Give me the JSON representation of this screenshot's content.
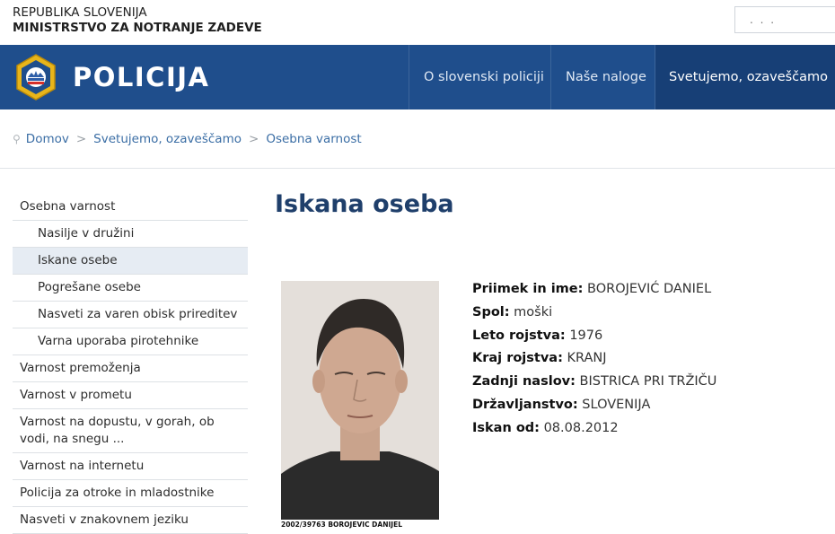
{
  "header": {
    "gov_line1": "REPUBLIKA SLOVENIJA",
    "gov_line2": "MINISTRSTVO ZA NOTRANJE ZADEVE",
    "search_placeholder": ". . ."
  },
  "nav": {
    "brand": "POLICIJA",
    "items": [
      {
        "label": "O slovenski policiji"
      },
      {
        "label": "Naše naloge"
      },
      {
        "label": "Svetujemo, ozaveščamo"
      }
    ]
  },
  "breadcrumb": [
    "Domov",
    "Svetujemo, ozaveščamo",
    "Osebna varnost"
  ],
  "sidebar": {
    "items": [
      {
        "label": "Osebna varnost"
      },
      {
        "label": "Nasilje v družini"
      },
      {
        "label": "Iskane osebe"
      },
      {
        "label": "Pogrešane osebe"
      },
      {
        "label": "Nasveti za varen obisk prireditev"
      },
      {
        "label": "Varna uporaba pirotehnike"
      },
      {
        "label": "Varnost premoženja"
      },
      {
        "label": "Varnost v prometu"
      },
      {
        "label": "Varnost na dopustu, v gorah, ob vodi, na snegu ..."
      },
      {
        "label": "Varnost na internetu"
      },
      {
        "label": "Policija za otroke in mladostnike"
      },
      {
        "label": "Nasveti v znakovnem jeziku"
      }
    ]
  },
  "main": {
    "title": "Iskana oseba",
    "photo_caption": "2002/39763 BOROJEVIC DANIJEL",
    "fields": [
      {
        "label": "Priimek in ime:",
        "value": "BOROJEVIĆ DANIEL"
      },
      {
        "label": "Spol:",
        "value": "moški"
      },
      {
        "label": "Leto rojstva:",
        "value": "1976"
      },
      {
        "label": "Kraj rojstva:",
        "value": "KRANJ"
      },
      {
        "label": "Zadnji naslov:",
        "value": "BISTRICA PRI TRŽIČU"
      },
      {
        "label": "Državljanstvo:",
        "value": "SLOVENIJA"
      },
      {
        "label": "Iskan od:",
        "value": "08.08.2012"
      }
    ]
  },
  "colors": {
    "navbar": "#1f4e8c",
    "title": "#1f3f6b",
    "link": "#3b6ea5",
    "badge": "#e8b51a"
  }
}
